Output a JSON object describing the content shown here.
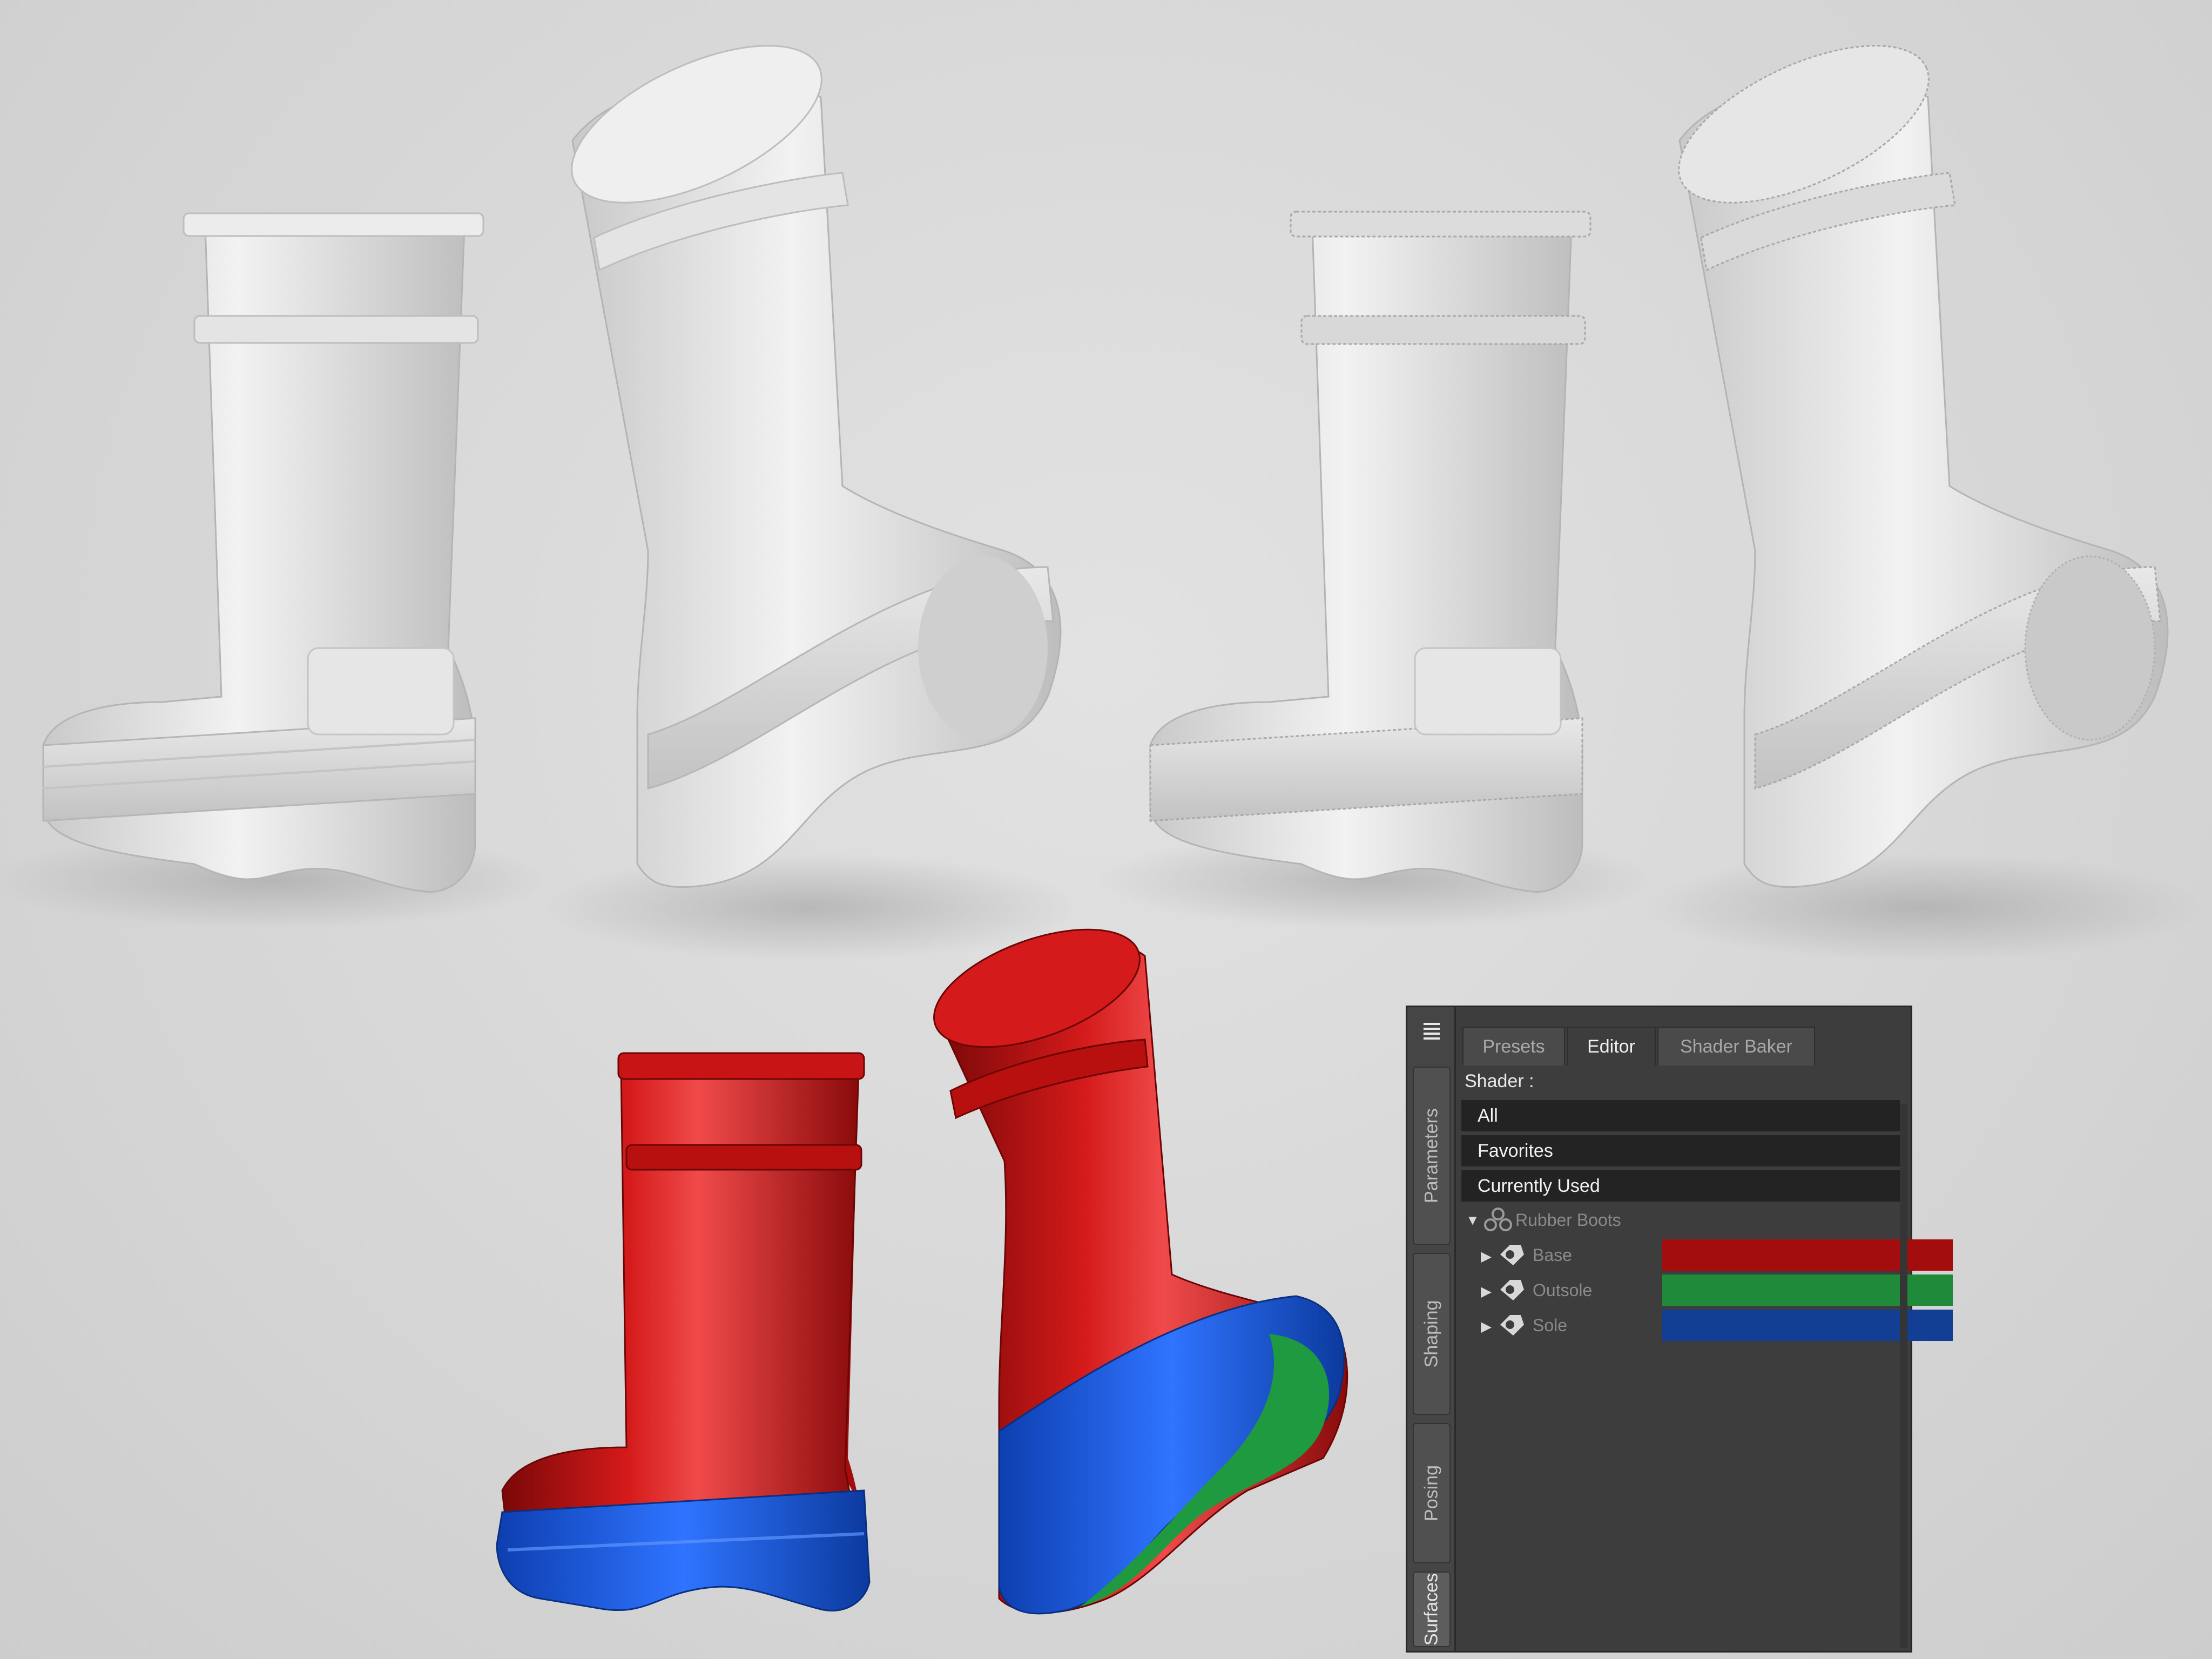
{
  "colors": {
    "base": "#a30d0d",
    "outsole": "#1f8a3a",
    "sole": "#123f93",
    "panel_bg": "#3d3d3d"
  },
  "panel": {
    "menu_icon": "panel-menu-icon",
    "side_tabs": [
      "Parameters",
      "Shaping",
      "Posing",
      "Surfaces"
    ],
    "active_side_tab": "Surfaces",
    "tabs": [
      "Presets",
      "Editor",
      "Shader Baker"
    ],
    "active_tab": "Editor",
    "shader_label": "Shader :",
    "shader_options": [
      "All",
      "Favorites",
      "Currently Used"
    ],
    "tree": {
      "root": "Rubber Boots",
      "items": [
        {
          "label": "Base",
          "color": "#a30d0d"
        },
        {
          "label": "Outsole",
          "color": "#1f8a3a"
        },
        {
          "label": "Sole",
          "color": "#123f93"
        }
      ]
    }
  }
}
